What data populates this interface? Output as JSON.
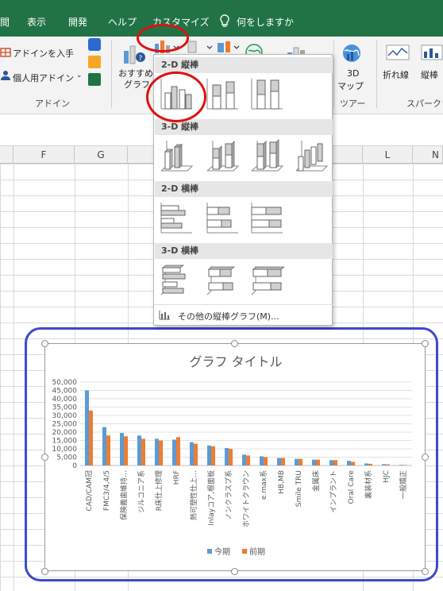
{
  "menu": {
    "items": [
      "閲",
      "表示",
      "開発",
      "ヘルプ",
      "カスタマイズ",
      "何をしますか"
    ]
  },
  "ribbon": {
    "addins_get": "アドインを入手",
    "addins_personal": "個人用アドイン",
    "addins_group_label": "アドイン",
    "recommended_line1": "おすすめ",
    "recommended_line2": "グラフ",
    "map3d_line1": "3D",
    "map3d_line2": "マップ",
    "tour_label": "ツアー",
    "sparkline_line": "折れ線",
    "sparkline_column": "縦棒",
    "sparkline_group_label": "スパークラ"
  },
  "columns": [
    "F",
    "G",
    "L",
    "N"
  ],
  "dropdown": {
    "section_2d_column": "2-D 縦棒",
    "section_3d_column": "3-D 縦棒",
    "section_2d_bar": "2-D 横棒",
    "section_3d_bar": "3-D 横棒",
    "more_charts": "その他の縦棒グラフ(M)..."
  },
  "chart_data": {
    "type": "bar",
    "title": "グラフ タイトル",
    "categories": [
      "CAD/CAM冠",
      "FMC3/4,4/5",
      "保険義歯維持…",
      "ジルコニア系",
      "R床仕上修理",
      "HRF",
      "熱可塑性仕上…",
      "Inlayコア,根面板",
      "ノンクラスプ系",
      "ホワイトクラウン",
      "e.max系",
      "HB,MB",
      "Smile TRU",
      "金属床",
      "インプラント",
      "Oral Care",
      "裏装材系",
      "HJC",
      "一般矯正"
    ],
    "series": [
      {
        "name": "今期",
        "color": "#5b9bd5",
        "values": [
          45000,
          23000,
          19500,
          18000,
          16000,
          15500,
          14000,
          12000,
          10500,
          6500,
          5500,
          4500,
          4000,
          3500,
          3200,
          2800,
          1200,
          800,
          400
        ]
      },
      {
        "name": "前期",
        "color": "#ed7d31",
        "values": [
          33000,
          18000,
          17500,
          16000,
          15000,
          17000,
          13000,
          11500,
          10000,
          6000,
          5000,
          4500,
          4000,
          3500,
          3200,
          2200,
          1000,
          700,
          300
        ]
      }
    ],
    "ylim": [
      0,
      50000
    ],
    "yticks": [
      "50,000",
      "45,000",
      "40,000",
      "35,000",
      "30,000",
      "25,000",
      "20,000",
      "15,000",
      "10,000",
      "5,000",
      "0"
    ],
    "grid": true,
    "legend": "bottom"
  }
}
